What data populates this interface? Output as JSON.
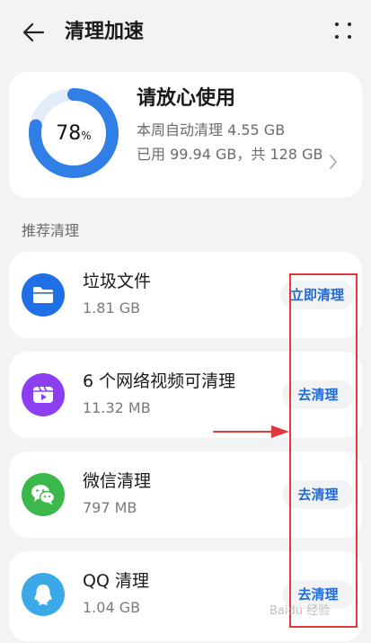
{
  "header": {
    "title": "清理加速",
    "back_icon": "arrow-left-icon",
    "more_icon": "more-dots-icon"
  },
  "storage": {
    "percent": "78",
    "percent_sign": "%",
    "percent_value": 0.78,
    "title": "请放心使用",
    "line1": "本周自动清理 4.55 GB",
    "line2": "已用 99.94 GB，共 128 GB",
    "ring_color": "#2f7fe6",
    "ring_track_color": "#e3ecf9"
  },
  "section": {
    "label": "推荐清理"
  },
  "items": [
    {
      "title": "垃圾文件",
      "size": "1.81 GB",
      "action": "立即清理",
      "icon": "folder-icon",
      "color": "#1f6fe6"
    },
    {
      "title": "6 个网络视频可清理",
      "size": "11.32 MB",
      "action": "去清理",
      "icon": "video-icon",
      "color": "#8b3ff0"
    },
    {
      "title": "微信清理",
      "size": "797 MB",
      "action": "去清理",
      "icon": "wechat-icon",
      "color": "#3cb84a"
    },
    {
      "title": "QQ 清理",
      "size": "1.04 GB",
      "action": "去清理",
      "icon": "qq-icon",
      "color": "#39a9e8"
    }
  ],
  "colors": {
    "accent": "#1e6ad9",
    "annotation": "#e2373b"
  },
  "watermark": "Baidu 经验"
}
